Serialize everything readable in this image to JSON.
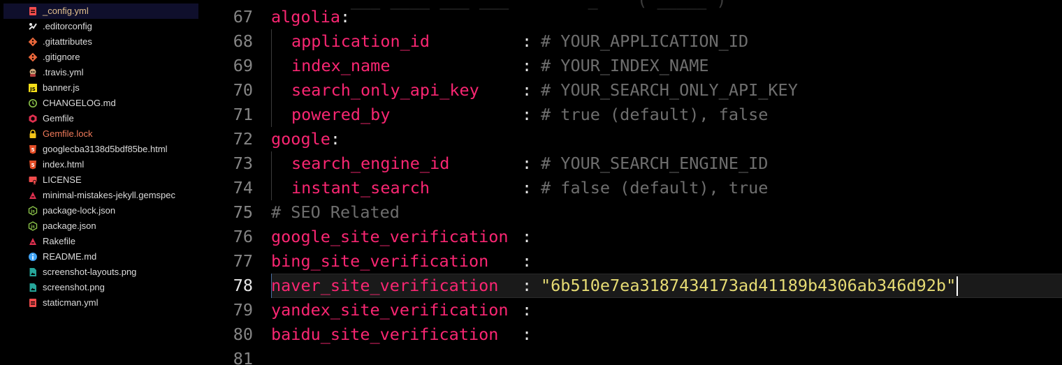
{
  "explorer": {
    "files": [
      {
        "name": "_config.yml",
        "icon": "yaml-file-icon",
        "icon_color": "#f14c4c",
        "active": true
      },
      {
        "name": ".editorconfig",
        "icon": "editorconfig-icon",
        "icon_color": "#e6e6e6"
      },
      {
        "name": ".gitattributes",
        "icon": "git-icon",
        "icon_color": "#e8663a"
      },
      {
        "name": ".gitignore",
        "icon": "git-icon",
        "icon_color": "#e8663a"
      },
      {
        "name": ".travis.yml",
        "icon": "travis-icon",
        "icon_color": "#cfa97c"
      },
      {
        "name": "banner.js",
        "icon": "javascript-icon",
        "icon_color": "#f5de19"
      },
      {
        "name": "CHANGELOG.md",
        "icon": "changelog-icon",
        "icon_color": "#8bc34a"
      },
      {
        "name": "Gemfile",
        "icon": "ruby-gem-icon",
        "icon_color": "#e0304f"
      },
      {
        "name": "Gemfile.lock",
        "icon": "lock-icon",
        "icon_color": "#f5c518",
        "git_status": "deleted"
      },
      {
        "name": "googlecba3138d5bdf85be.html",
        "icon": "html-icon",
        "icon_color": "#e44d26"
      },
      {
        "name": "index.html",
        "icon": "html-icon",
        "icon_color": "#e44d26"
      },
      {
        "name": "LICENSE",
        "icon": "license-icon",
        "icon_color": "#f14c4c"
      },
      {
        "name": "minimal-mistakes-jekyll.gemspec",
        "icon": "rake-icon",
        "icon_color": "#e0304f"
      },
      {
        "name": "package-lock.json",
        "icon": "nodejs-icon",
        "icon_color": "#8bc34a"
      },
      {
        "name": "package.json",
        "icon": "nodejs-icon",
        "icon_color": "#8bc34a"
      },
      {
        "name": "Rakefile",
        "icon": "rake-icon",
        "icon_color": "#e0304f"
      },
      {
        "name": "README.md",
        "icon": "info-icon",
        "icon_color": "#42a5f5"
      },
      {
        "name": "screenshot-layouts.png",
        "icon": "image-icon",
        "icon_color": "#26a69a"
      },
      {
        "name": "screenshot.png",
        "icon": "image-icon",
        "icon_color": "#26a69a"
      },
      {
        "name": "staticman.yml",
        "icon": "yaml-file-icon",
        "icon_color": "#f14c4c"
      }
    ]
  },
  "editor": {
    "current_line": "78",
    "lines": [
      {
        "num": "67",
        "key": "algolia",
        "indent": false,
        "colon": ":",
        "comment": "",
        "string": ""
      },
      {
        "num": "68",
        "key": "application_id",
        "indent": true,
        "colon": ":",
        "comment": "# YOUR_APPLICATION_ID",
        "string": ""
      },
      {
        "num": "69",
        "key": "index_name",
        "indent": true,
        "colon": ":",
        "comment": "# YOUR_INDEX_NAME",
        "string": ""
      },
      {
        "num": "70",
        "key": "search_only_api_key",
        "indent": true,
        "colon": ":",
        "comment": "# YOUR_SEARCH_ONLY_API_KEY",
        "string": ""
      },
      {
        "num": "71",
        "key": "powered_by",
        "indent": true,
        "colon": ":",
        "comment": "# true (default), false",
        "string": ""
      },
      {
        "num": "72",
        "key": "google",
        "indent": false,
        "colon": ":",
        "comment": "",
        "string": ""
      },
      {
        "num": "73",
        "key": "search_engine_id",
        "indent": true,
        "colon": ":",
        "comment": "# YOUR_SEARCH_ENGINE_ID",
        "string": ""
      },
      {
        "num": "74",
        "key": "instant_search",
        "indent": true,
        "colon": ":",
        "comment": "# false (default), true",
        "string": ""
      },
      {
        "num": "75",
        "key": "",
        "indent": false,
        "colon": "",
        "comment": "# SEO Related",
        "string": ""
      },
      {
        "num": "76",
        "key": "google_site_verification",
        "indent": false,
        "colon": ":",
        "comment": "",
        "string": ""
      },
      {
        "num": "77",
        "key": "bing_site_verification",
        "indent": false,
        "colon": ":",
        "comment": "",
        "string": ""
      },
      {
        "num": "78",
        "key": "naver_site_verification",
        "indent": false,
        "colon": ":",
        "comment": "",
        "string": "\"6b510e7ea3187434173ad41189b4306ab346d92b\""
      },
      {
        "num": "79",
        "key": "yandex_site_verification",
        "indent": false,
        "colon": ":",
        "comment": "",
        "string": ""
      },
      {
        "num": "80",
        "key": "baidu_site_verification",
        "indent": false,
        "colon": ":",
        "comment": "",
        "string": ""
      },
      {
        "num": "81",
        "key": "",
        "indent": false,
        "colon": "",
        "comment": "",
        "string": ""
      }
    ]
  },
  "colors": {
    "key": "#f92672",
    "comment": "#6e6e6e",
    "string": "#e6db74",
    "line_number": "#858585",
    "active_file": "#e2c08d"
  }
}
